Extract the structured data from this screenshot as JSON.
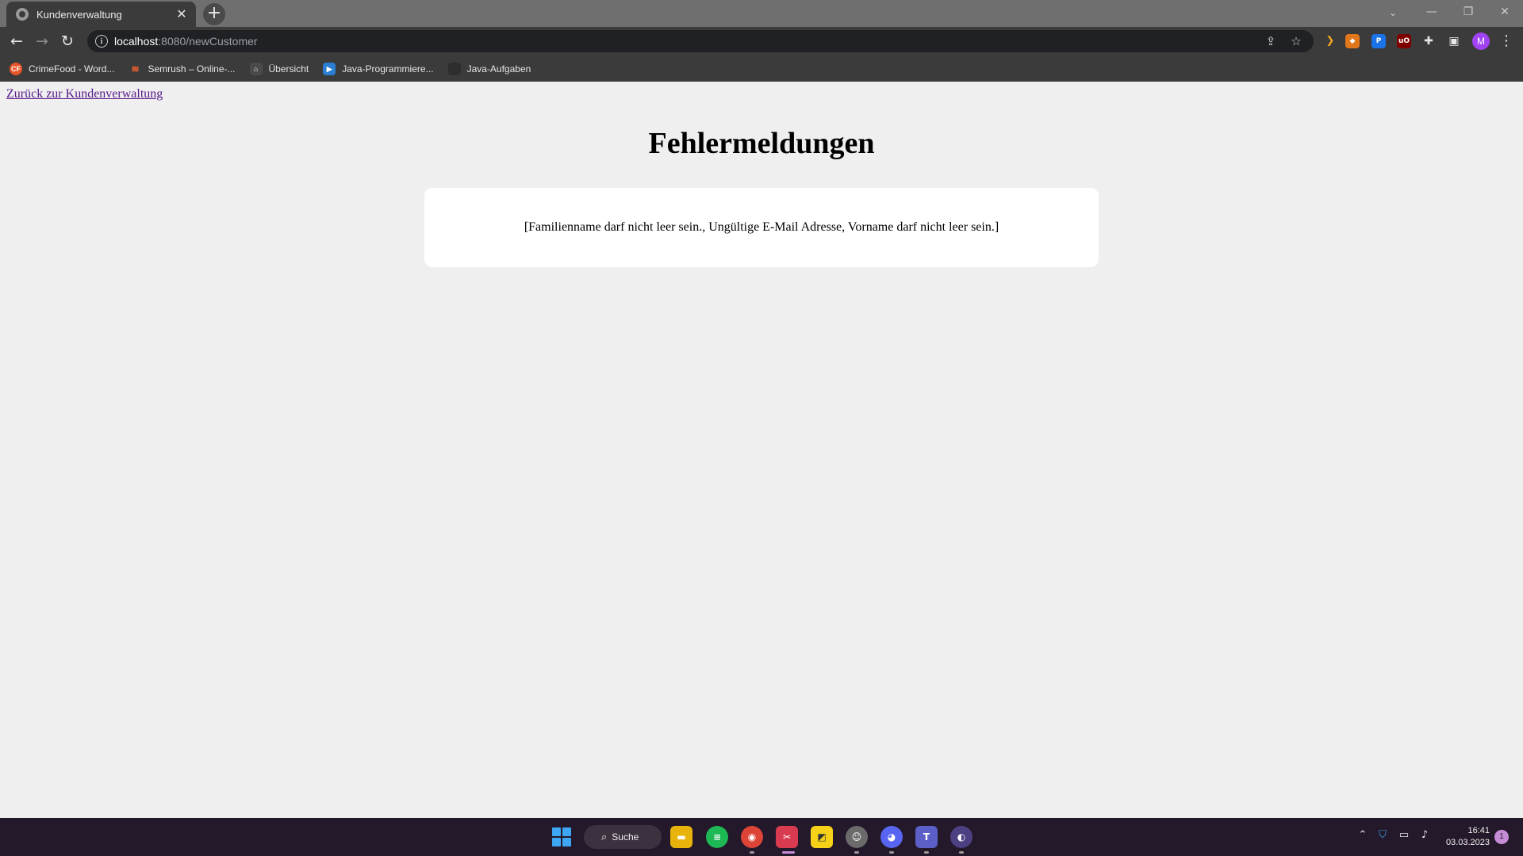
{
  "browser": {
    "tab": {
      "title": "Kundenverwaltung",
      "close_glyph": "✕",
      "favicon": "globe-icon"
    },
    "new_tab_glyph": "+",
    "window_controls": {
      "tab_search": "⌄",
      "minimize": "—",
      "restore": "❐",
      "close": "✕"
    },
    "address": {
      "host": "localhost",
      "rest": ":8080/newCustomer"
    },
    "bookmarks": [
      {
        "label": "CrimeFood - Word...",
        "icon": "CF",
        "color": "#e8542a"
      },
      {
        "label": "Semrush – Online-...",
        "icon": "≋",
        "color": "#ff642d"
      },
      {
        "label": "Übersicht",
        "icon": "⌂",
        "color": "#4a4a4a"
      },
      {
        "label": "Java-Programmiere...",
        "icon": "▶",
        "color": "#2a7fd4"
      },
      {
        "label": "Java-Aufgaben",
        "icon": "",
        "color": "#2e2e2e"
      }
    ],
    "profile_initial": "M"
  },
  "page": {
    "back_link": "Zurück zur Kundenverwaltung",
    "heading": "Fehlermeldungen",
    "error_text": "[Familienname darf nicht leer sein., Ungültige E-Mail Adresse, Vorname darf nicht leer sein.]"
  },
  "taskbar": {
    "search_label": "Suche",
    "time": "16:41",
    "date": "03.03.2023",
    "notification_count": "1"
  }
}
